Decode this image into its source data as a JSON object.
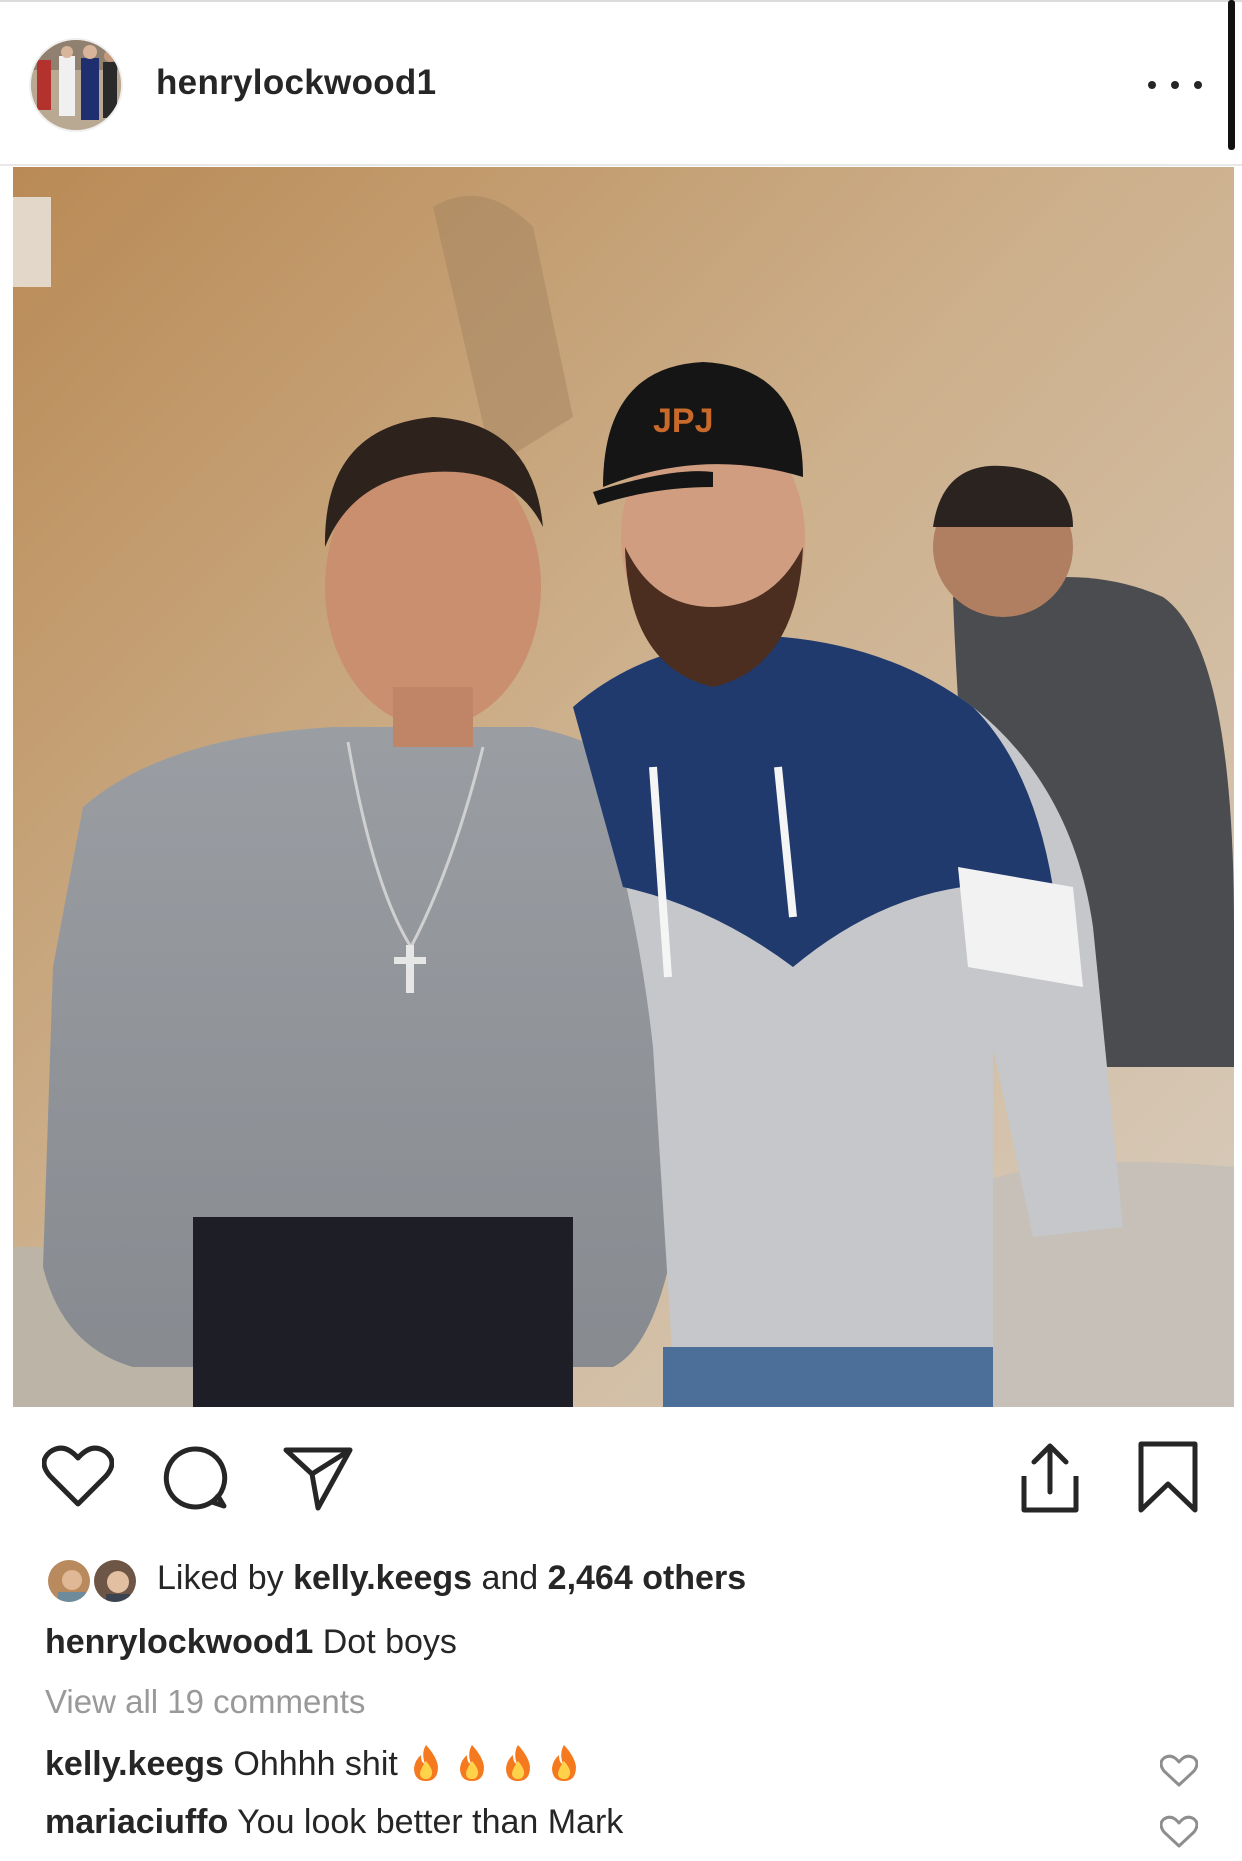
{
  "post": {
    "username": "henrylockwood1",
    "photo_alt": ""
  },
  "icons": {
    "more": "more-options-icon",
    "like": "heart-outline-icon",
    "comment": "comment-bubble-icon",
    "share": "paper-plane-icon",
    "upload": "share-upload-icon",
    "save": "bookmark-outline-icon"
  },
  "likes": {
    "prefix": "Liked by ",
    "liker": "kelly.keegs",
    "middle": " and ",
    "count_text": "2,464 others"
  },
  "caption": {
    "username": "henrylockwood1",
    "text": "Dot boys"
  },
  "view_all": "View all 19 comments",
  "comments": [
    {
      "username": "kelly.keegs",
      "text": "Ohhhh shit",
      "emoji": "🔥🔥🔥🔥"
    },
    {
      "username": "mariaciuffo",
      "text": "You look better than Mark",
      "emoji": ""
    }
  ],
  "colors": {
    "text": "#262626",
    "muted": "#999999",
    "divider": "#e8e8e8"
  }
}
